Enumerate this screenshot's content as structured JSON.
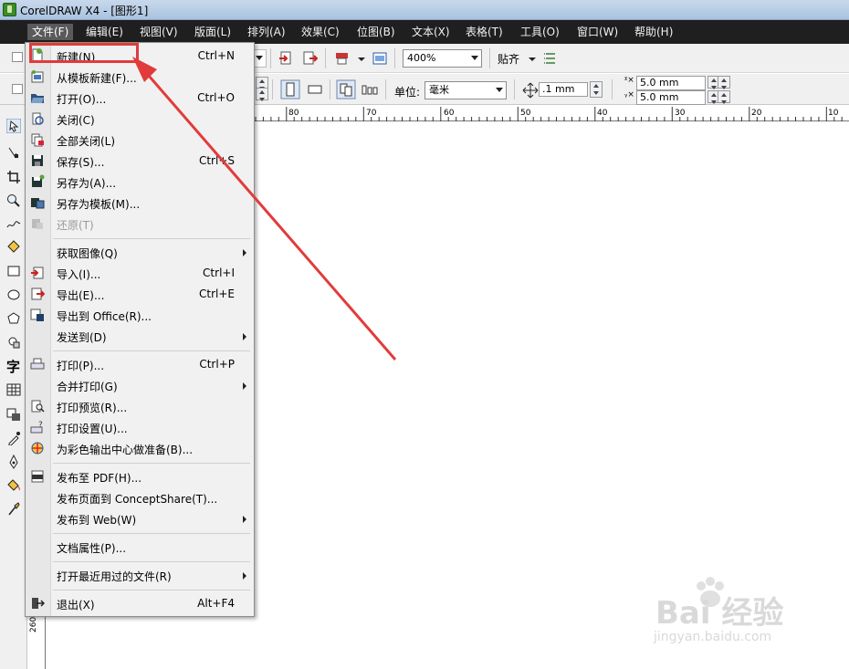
{
  "window": {
    "title": "CorelDRAW X4 - [图形1]"
  },
  "menubar": [
    "文件(F)",
    "编辑(E)",
    "视图(V)",
    "版面(L)",
    "排列(A)",
    "效果(C)",
    "位图(B)",
    "文本(X)",
    "表格(T)",
    "工具(O)",
    "窗口(W)",
    "帮助(H)"
  ],
  "toolbar": {
    "zoom": "400%",
    "snap": "贴齐",
    "unit_label": "单位:",
    "unit": "毫米",
    "nudge": ".1 mm",
    "dup_x": "5.0 mm",
    "dup_y": "5.0 mm"
  },
  "ruler": {
    "h_labels": [
      "80",
      "70",
      "60",
      "50",
      "40",
      "30",
      "20",
      "10"
    ],
    "v_label": "260"
  },
  "file_menu": [
    {
      "label": "新建(N)",
      "shortcut": "Ctrl+N",
      "icon": "new-document-icon"
    },
    {
      "label": "从模板新建(F)...",
      "shortcut": "",
      "icon": "template-icon"
    },
    {
      "label": "打开(O)...",
      "shortcut": "Ctrl+O",
      "icon": "open-folder-icon"
    },
    {
      "label": "关闭(C)",
      "shortcut": "",
      "icon": "close-doc-icon"
    },
    {
      "label": "全部关闭(L)",
      "shortcut": "",
      "icon": "close-all-icon"
    },
    {
      "label": "保存(S)...",
      "shortcut": "Ctrl+S",
      "icon": "save-icon"
    },
    {
      "label": "另存为(A)...",
      "shortcut": "",
      "icon": "save-as-icon"
    },
    {
      "label": "另存为模板(M)...",
      "shortcut": "",
      "icon": "save-template-icon"
    },
    {
      "label": "还原(T)",
      "shortcut": "",
      "icon": "revert-icon",
      "disabled": true
    },
    {
      "label": "获取图像(Q)",
      "shortcut": "",
      "submenu": true
    },
    {
      "label": "导入(I)...",
      "shortcut": "Ctrl+I",
      "icon": "import-icon"
    },
    {
      "label": "导出(E)...",
      "shortcut": "Ctrl+E",
      "icon": "export-icon"
    },
    {
      "label": "导出到 Office(R)...",
      "shortcut": "",
      "icon": "export-office-icon"
    },
    {
      "label": "发送到(D)",
      "shortcut": "",
      "submenu": true
    },
    {
      "label": "打印(P)...",
      "shortcut": "Ctrl+P",
      "icon": "print-icon"
    },
    {
      "label": "合并打印(G)",
      "shortcut": "",
      "submenu": true
    },
    {
      "label": "打印预览(R)...",
      "shortcut": "",
      "icon": "print-preview-icon"
    },
    {
      "label": "打印设置(U)...",
      "shortcut": "",
      "icon": "print-setup-icon"
    },
    {
      "label": "为彩色输出中心做准备(B)...",
      "shortcut": "",
      "icon": "color-output-icon"
    },
    {
      "label": "发布至 PDF(H)...",
      "shortcut": "",
      "icon": "pdf-icon"
    },
    {
      "label": "发布页面到 ConceptShare(T)...",
      "shortcut": ""
    },
    {
      "label": "发布到 Web(W)",
      "shortcut": "",
      "submenu": true
    },
    {
      "label": "文档属性(P)...",
      "shortcut": ""
    },
    {
      "label": "打开最近用过的文件(R)",
      "shortcut": "",
      "submenu": true
    },
    {
      "label": "退出(X)",
      "shortcut": "Alt+F4",
      "icon": "exit-icon"
    }
  ],
  "watermark": {
    "text": "Bai 经验",
    "url": "jingyan.baidu.com"
  },
  "colors": {
    "highlight": "#e23b3b",
    "menubar": "#1f1f1f"
  }
}
